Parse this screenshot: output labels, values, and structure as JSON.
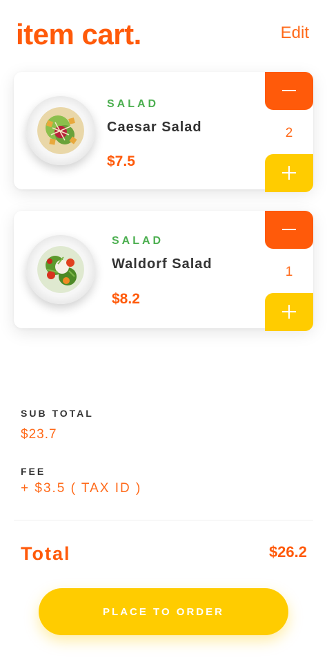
{
  "header": {
    "title": "item cart.",
    "edit_label": "Edit"
  },
  "items": [
    {
      "category": "SALAD",
      "name": "Caesar Salad",
      "price": "$7.5",
      "quantity": "2"
    },
    {
      "category": "SALAD",
      "name": "Waldorf Salad",
      "price": "$8.2",
      "quantity": "1"
    }
  ],
  "summary": {
    "subtotal_label": "SUB TOTAL",
    "subtotal_value": "$23.7",
    "fee_label": "FEE",
    "fee_value": "+ $3.5 ( TAX ID )",
    "total_label": "Total",
    "total_value": "$26.2"
  },
  "order_button": {
    "label": "PLACE TO ORDER"
  },
  "colors": {
    "accent": "#ff5a0a",
    "secondary": "#ffcc00",
    "category": "#4caf50",
    "text": "#333333"
  },
  "icons": {
    "minus": "minus-icon",
    "plus": "plus-icon"
  }
}
